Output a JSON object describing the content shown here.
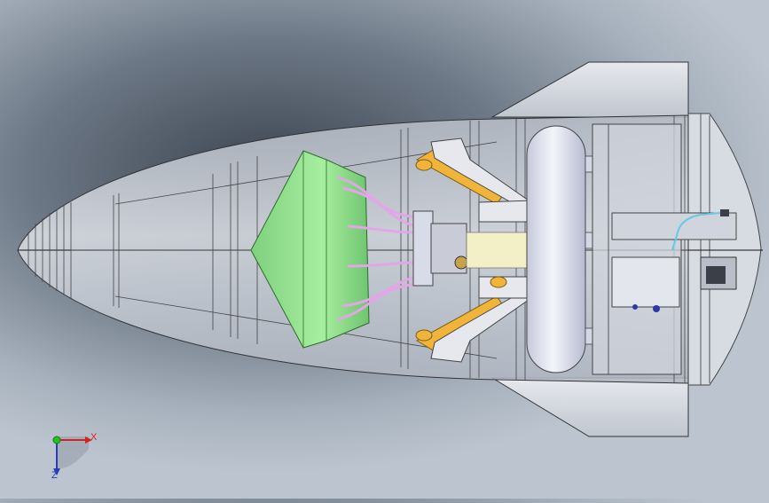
{
  "view": {
    "model_name": "missile-nose-section",
    "colors": {
      "background_center": "#3c4450",
      "background_edge": "#bcc5cf",
      "shell": "#c9ced6",
      "parachute_cone": "#8fe08f",
      "tank": "#e3e6f2",
      "arm": "#f0b43a",
      "harness": "#e2a6e8",
      "pipe": "#64c8e8"
    }
  },
  "triad": {
    "x_label": "X",
    "z_label": "Z",
    "x_color": "#d22222",
    "y_color": "#22c022",
    "z_color": "#2a3bb8"
  }
}
